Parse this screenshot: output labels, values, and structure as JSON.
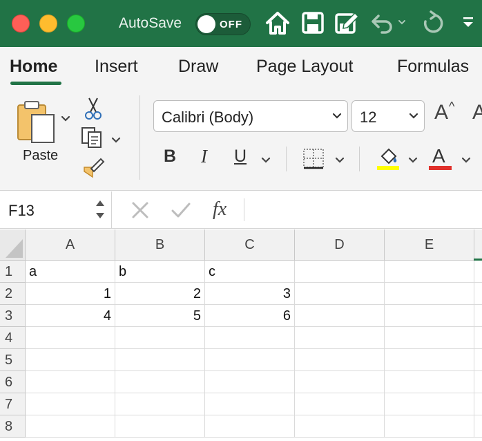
{
  "titlebar": {
    "autosave_label": "AutoSave",
    "autosave_state": "OFF",
    "accent_color": "#217346",
    "icons": [
      "home-icon",
      "save-icon",
      "edit-save-icon",
      "undo-icon",
      "redo-icon",
      "customize-toolbar-icon"
    ]
  },
  "tabs": [
    {
      "label": "Home",
      "active": true
    },
    {
      "label": "Insert",
      "active": false
    },
    {
      "label": "Draw",
      "active": false
    },
    {
      "label": "Page Layout",
      "active": false
    },
    {
      "label": "Formulas",
      "active": false
    }
  ],
  "ribbon": {
    "paste_label": "Paste",
    "font_name": "Calibri (Body)",
    "font_size": "12",
    "increase_font_glyph": "A",
    "bold": "B",
    "italic": "I",
    "underline": "U",
    "font_color_glyph": "A",
    "highlight_color": "#ffff00",
    "font_color": "#e0302b"
  },
  "formula_bar": {
    "name_box": "F13",
    "fx": "fx",
    "formula": ""
  },
  "sheet": {
    "columns": [
      "A",
      "B",
      "C",
      "D",
      "E"
    ],
    "rows": [
      "1",
      "2",
      "3",
      "4",
      "5",
      "6",
      "7",
      "8"
    ],
    "cells": {
      "A1": "a",
      "B1": "b",
      "C1": "c",
      "A2": "1",
      "B2": "2",
      "C2": "3",
      "A3": "4",
      "B3": "5",
      "C3": "6"
    }
  }
}
